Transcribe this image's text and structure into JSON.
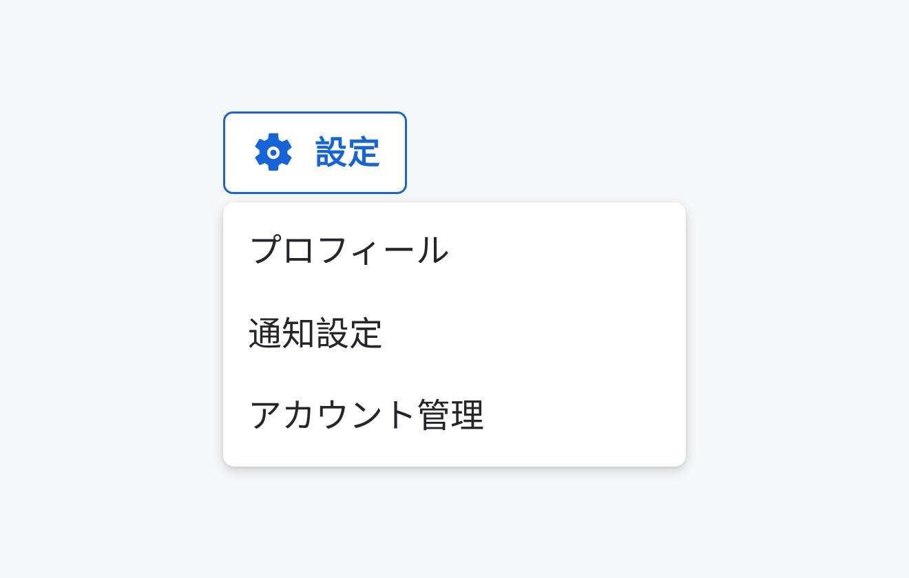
{
  "settings_button": {
    "label": "設定",
    "icon": "gear-icon",
    "accent_color": "#1565d8"
  },
  "menu": {
    "items": [
      {
        "label": "プロフィール"
      },
      {
        "label": "通知設定"
      },
      {
        "label": "アカウント管理"
      }
    ]
  }
}
